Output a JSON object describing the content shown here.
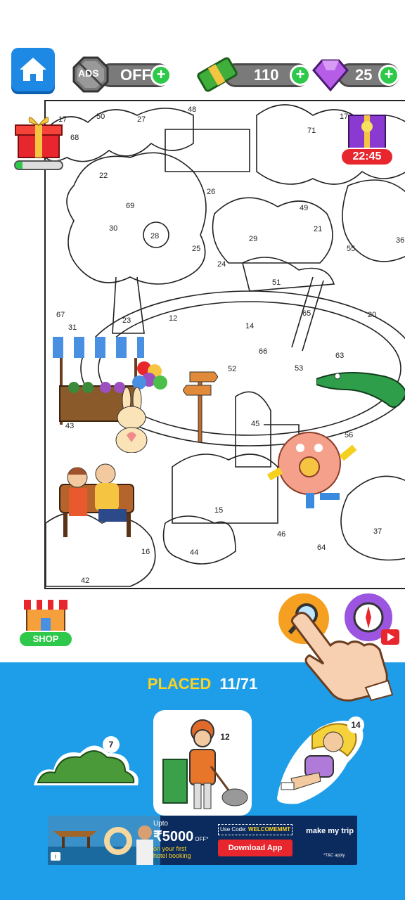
{
  "hud": {
    "ads_label": "ADS",
    "ads_state": "OFF",
    "cash_value": "110",
    "gem_value": "25",
    "plus": "+"
  },
  "gift": {
    "progress": 0.15
  },
  "timer": {
    "value": "22:45"
  },
  "numbers": [
    "17",
    "50",
    "27",
    "48",
    "17",
    "68",
    "71",
    "22",
    "26",
    "69",
    "49",
    "30",
    "28",
    "21",
    "29",
    "25",
    "55",
    "36",
    "24",
    "51",
    "67",
    "23",
    "12",
    "65",
    "20",
    "31",
    "14",
    "66",
    "63",
    "52",
    "53",
    "43",
    "45",
    "56",
    "15",
    "46",
    "37",
    "64",
    "16",
    "44",
    "42"
  ],
  "shop": {
    "label": "SHOP"
  },
  "progress": {
    "label": "PLACED",
    "count": "11/71"
  },
  "stickers": [
    {
      "number": "7",
      "name": "bush"
    },
    {
      "number": "12",
      "name": "street sweeper"
    },
    {
      "number": "14",
      "name": "girl sitting"
    }
  ],
  "ad": {
    "upto": "Upto",
    "amount": "₹5000",
    "off": "OFF*",
    "line1": "on your first",
    "line2": "hotel booking",
    "code_label": "Use Code:",
    "code": "WELCOMEMMT",
    "cta": "Download App",
    "brand": "make my trip",
    "tc": "*T&C apply"
  },
  "colors": {
    "accent_blue": "#1e9ee8",
    "placed_yellow": "#ffd21f",
    "plus_green": "#2ec84a",
    "timer_red": "#e8262e",
    "ad_red": "#e8262e"
  }
}
